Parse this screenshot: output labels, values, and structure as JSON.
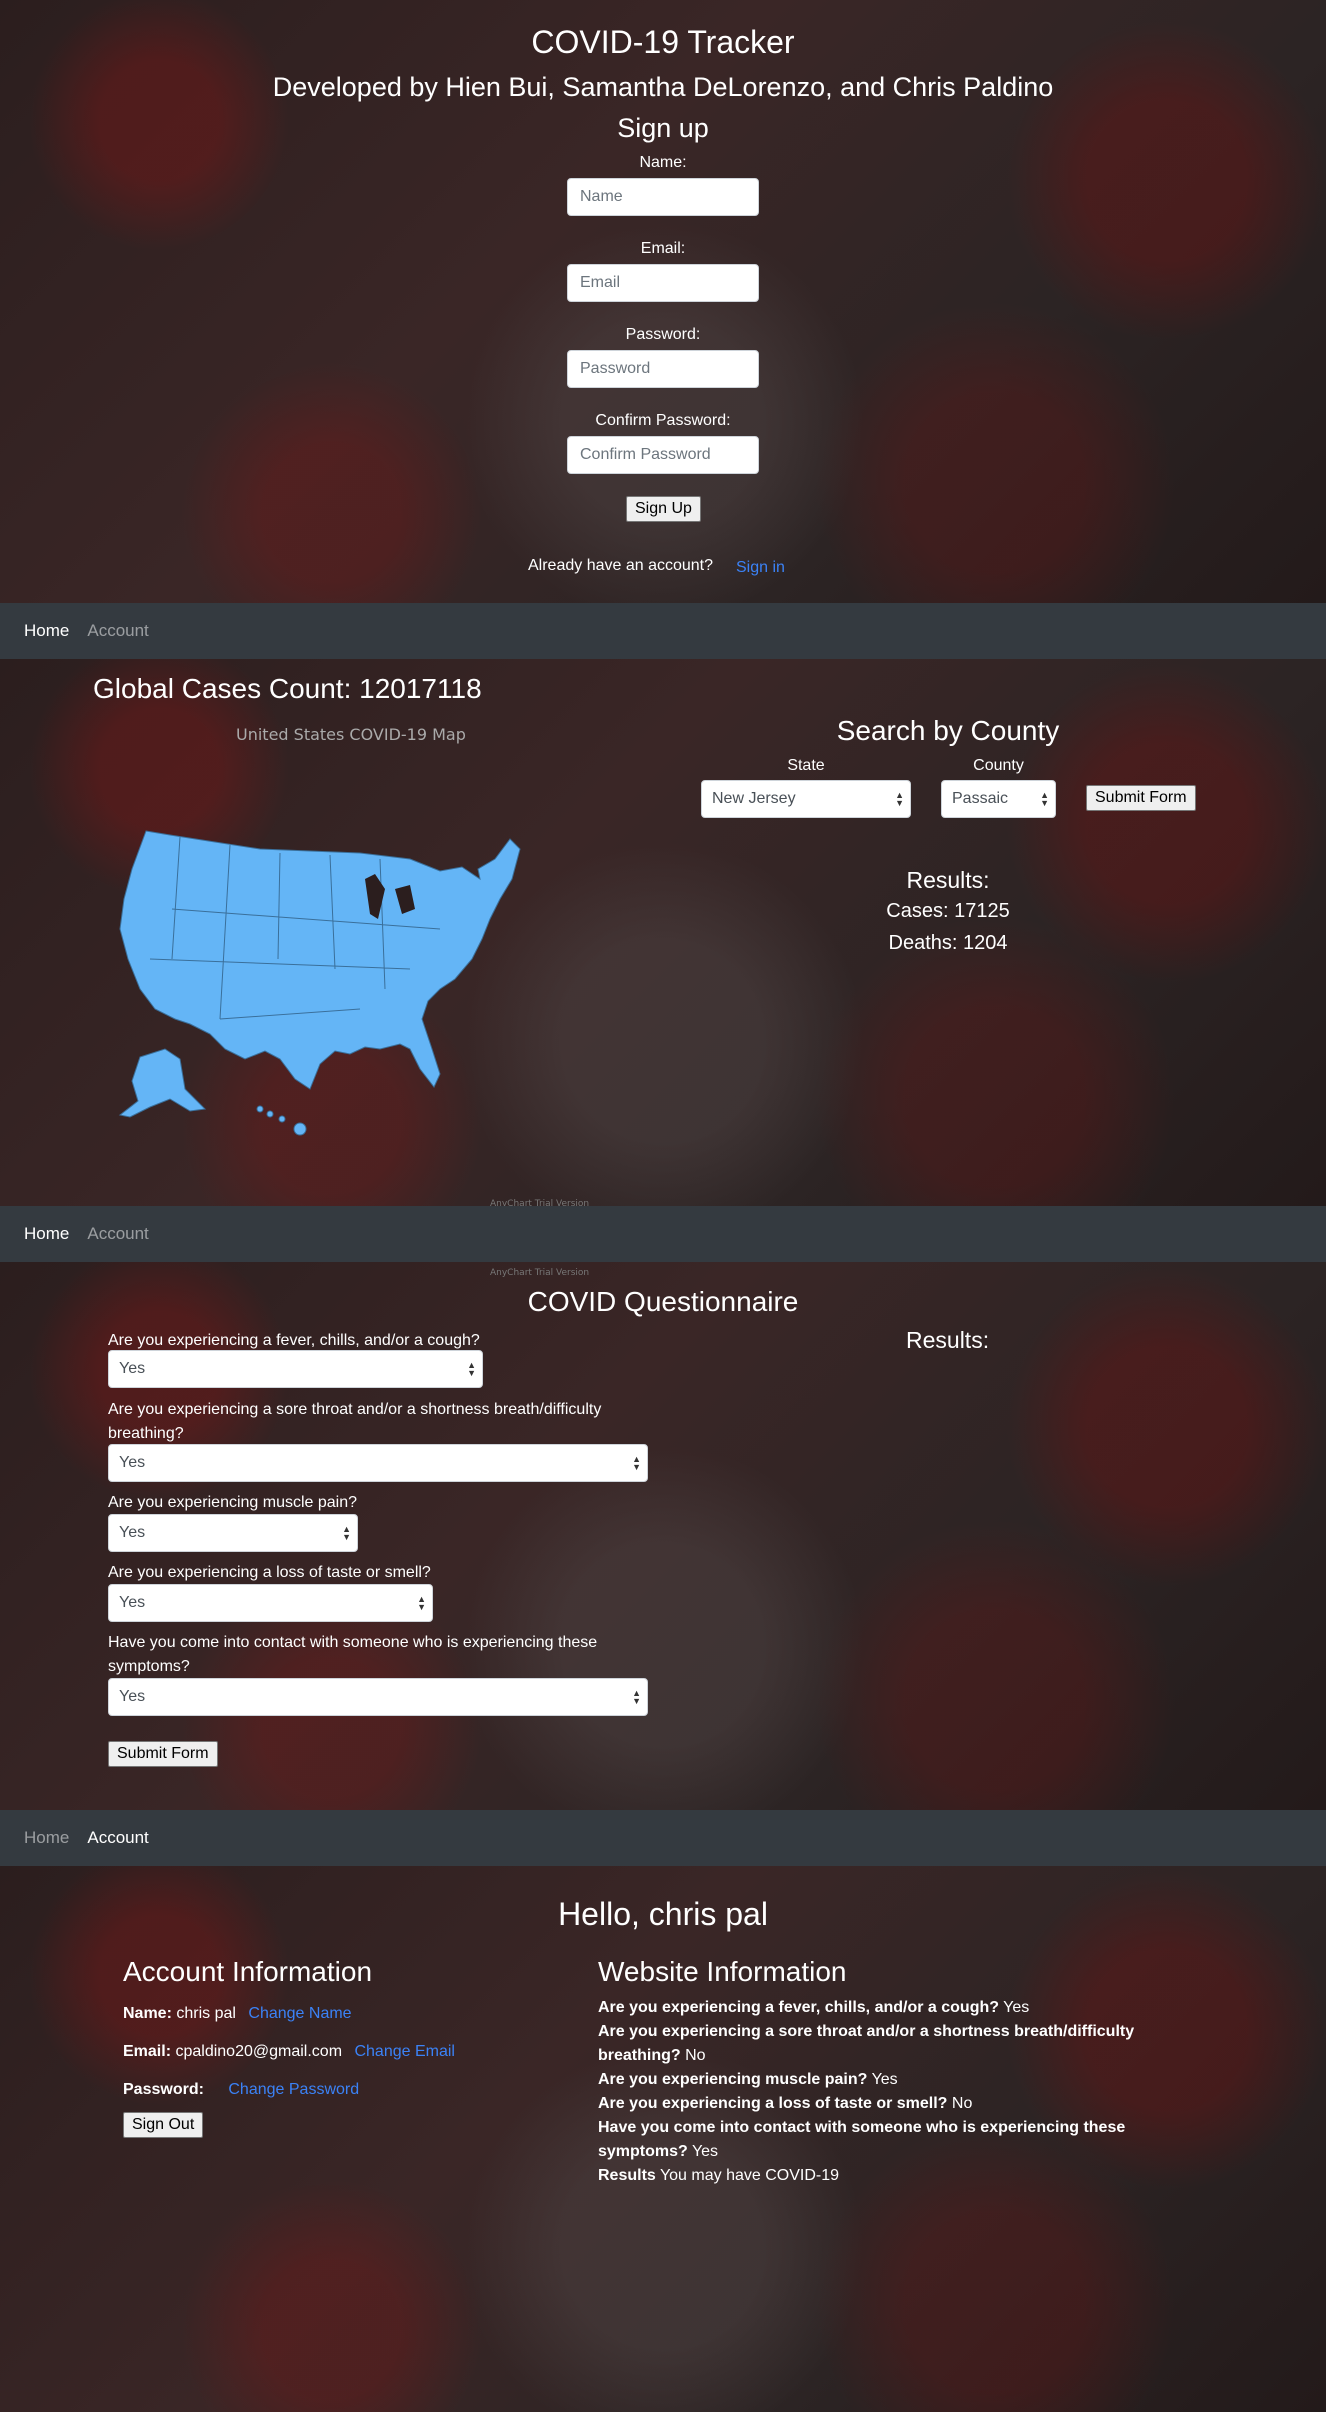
{
  "signup": {
    "title": "COVID-19 Tracker",
    "developers": "Developed by Hien Bui, Samantha DeLorenzo, and Chris Paldino",
    "heading": "Sign up",
    "name_label": "Name:",
    "name_placeholder": "Name",
    "email_label": "Email:",
    "email_placeholder": "Email",
    "password_label": "Password:",
    "password_placeholder": "Password",
    "confirm_label": "Confirm Password:",
    "confirm_placeholder": "Confirm Password",
    "signup_button": "Sign Up",
    "already_text": "Already have an account?",
    "signin_link": "Sign in"
  },
  "nav1": {
    "home": "Home",
    "account": "Account",
    "active": "Home"
  },
  "home": {
    "global_cases": "Global Cases Count: 12017118",
    "map_title": "United States COVID-19 Map",
    "map_watermark": "AnyChart Trial Version",
    "search_heading": "Search by County",
    "state_label": "State",
    "state_value": "New Jersey",
    "county_label": "County",
    "county_value": "Passaic",
    "submit_button": "Submit Form",
    "results_heading": "Results:",
    "cases": "Cases: 17125",
    "deaths": "Deaths: 1204"
  },
  "nav2": {
    "home": "Home",
    "account": "Account",
    "active": "Home"
  },
  "questionnaire": {
    "watermark": "AnyChart Trial Version",
    "title": "COVID Questionnaire",
    "results_heading": "Results:",
    "q1": "Are you experiencing a fever, chills, and/or a cough?",
    "q1_value": "Yes",
    "q2": "Are you experiencing a sore throat and/or a shortness breath/difficulty breathing?",
    "q2_value": "Yes",
    "q3": "Are you experiencing muscle pain?",
    "q3_value": "Yes",
    "q4": "Are you experiencing a loss of taste or smell?",
    "q4_value": "Yes",
    "q5": "Have you come into contact with someone who is experiencing these symptoms?",
    "q5_value": "Yes",
    "submit_button": "Submit Form"
  },
  "nav3": {
    "home": "Home",
    "account": "Account",
    "active": "Account"
  },
  "account": {
    "greeting": "Hello, chris pal",
    "info_heading": "Account Information",
    "name_label": "Name:",
    "name_value": "chris pal",
    "change_name": "Change Name",
    "email_label": "Email:",
    "email_value": "cpaldino20@gmail.com",
    "change_email": "Change Email",
    "password_label": "Password:",
    "change_password": "Change Password",
    "signout_button": "Sign Out",
    "website_heading": "Website Information",
    "w_q1": "Are you experiencing a fever, chills, and/or a cough?",
    "w_a1": "Yes",
    "w_q2": "Are you experiencing a sore throat and/or a shortness breath/difficulty breathing?",
    "w_a2": "No",
    "w_q3": "Are you experiencing muscle pain?",
    "w_a3": "Yes",
    "w_q4": "Are you experiencing a loss of taste or smell?",
    "w_a4": "No",
    "w_q5": "Have you come into contact with someone who is experiencing these symptoms?",
    "w_a5": "Yes",
    "results_label": "Results",
    "results_value": "You may have COVID-19"
  },
  "colors": {
    "map_fill": "#64b5f6",
    "navbar": "#343a40",
    "link": "#3b82f6"
  }
}
